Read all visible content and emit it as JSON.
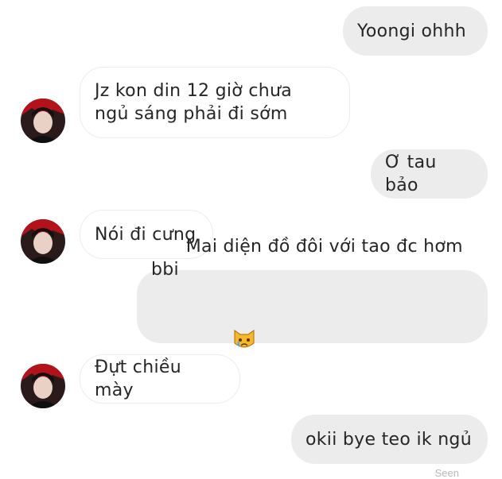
{
  "conversation": {
    "messages": [
      {
        "sender": "me",
        "text": "Yoongi ohhh"
      },
      {
        "sender": "them",
        "text": "Jz kon din 12 giờ chưa\nngủ sáng phải đi sớm"
      },
      {
        "sender": "me",
        "text": "Ơ tau bảo"
      },
      {
        "sender": "them",
        "text": "Nói đi cưng"
      },
      {
        "sender": "me",
        "text": "Mai diện đồ đôi với tao đc hơm bbi",
        "emoji": "crying-cat-face"
      },
      {
        "sender": "them",
        "text": "Đựt chiều mày"
      },
      {
        "sender": "me",
        "text": "okii bye teo ik ngủ"
      }
    ],
    "seen_label": "Seen"
  },
  "theme": {
    "outgoing_bubble": "#ececec",
    "incoming_border": "#ececec",
    "text": "#262626"
  }
}
